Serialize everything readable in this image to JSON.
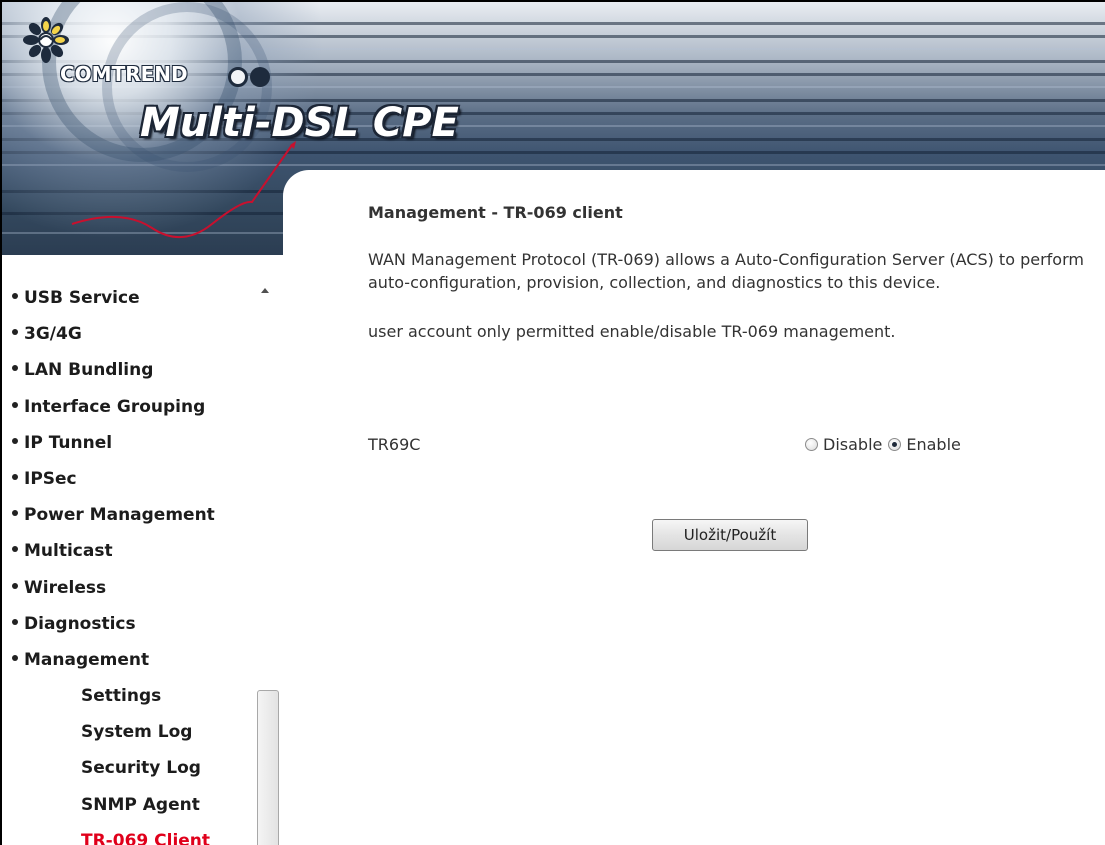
{
  "brand": {
    "company": "COMTREND",
    "product": "Multi-DSL CPE"
  },
  "sidebar": {
    "items": [
      {
        "label": "USB Service"
      },
      {
        "label": "3G/4G"
      },
      {
        "label": "LAN Bundling"
      },
      {
        "label": "Interface Grouping"
      },
      {
        "label": "IP Tunnel"
      },
      {
        "label": "IPSec"
      },
      {
        "label": "Power Management"
      },
      {
        "label": "Multicast"
      },
      {
        "label": "Wireless"
      },
      {
        "label": "Diagnostics"
      },
      {
        "label": "Management"
      }
    ],
    "subitems": [
      {
        "label": "Settings"
      },
      {
        "label": "System Log"
      },
      {
        "label": "Security Log"
      },
      {
        "label": "SNMP Agent"
      },
      {
        "label": "TR-069 Client",
        "active": true
      }
    ]
  },
  "main": {
    "title": "Management - TR-069 client",
    "description": "WAN Management Protocol (TR-069) allows a Auto-Configuration Server (ACS) to perform auto-configuration, provision, collection, and diagnostics to this device.",
    "note": "user account only permitted enable/disable TR-069 management.",
    "tr69": {
      "label": "TR69C",
      "options": [
        {
          "label": "Disable",
          "checked": false
        },
        {
          "label": "Enable",
          "checked": true
        }
      ]
    },
    "save_label": "Uložit/Použít"
  },
  "colors": {
    "active_menu": "#e0001b",
    "banner_dark": "#34495f"
  }
}
